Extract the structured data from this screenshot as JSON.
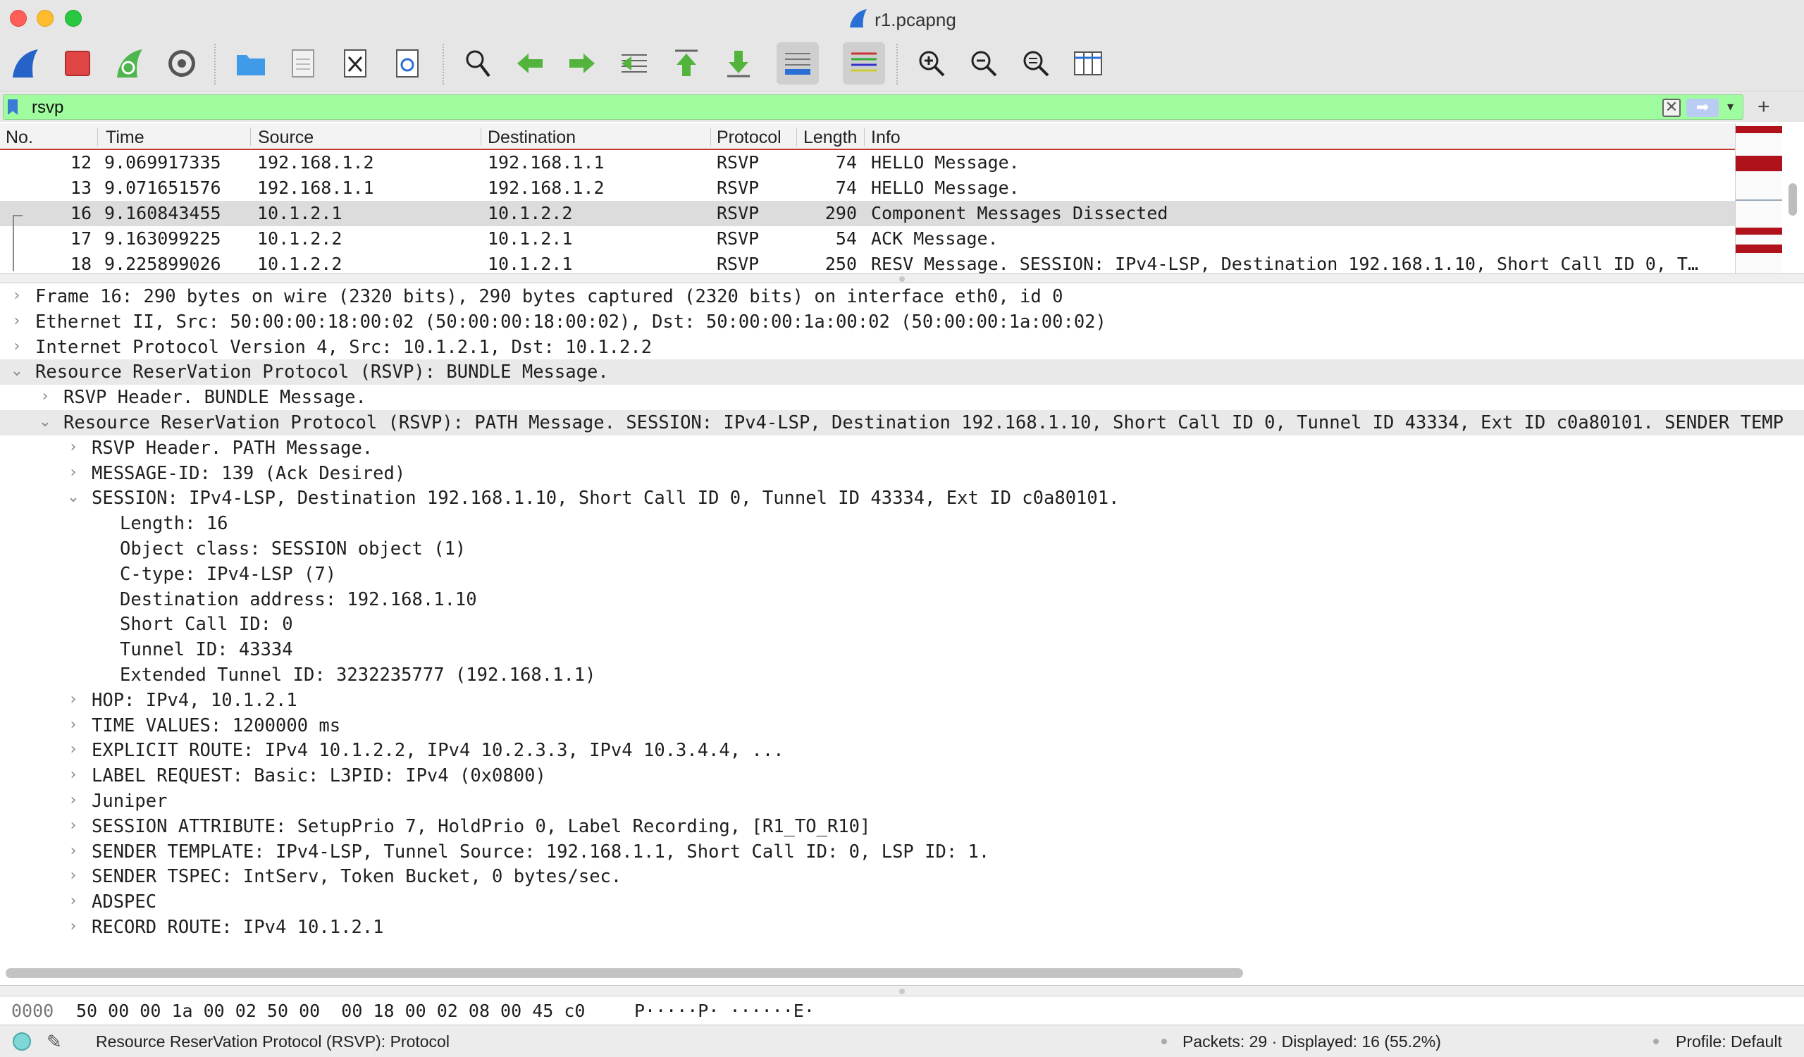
{
  "window": {
    "title": "r1.pcapng"
  },
  "toolbar": {
    "buttons": [
      {
        "icon": "start-capture-icon"
      },
      {
        "icon": "stop-capture-icon"
      },
      {
        "icon": "restart-capture-icon"
      },
      {
        "icon": "capture-options-icon"
      },
      {
        "icon": "open-file-icon"
      },
      {
        "icon": "save-file-icon"
      },
      {
        "icon": "close-file-icon"
      },
      {
        "icon": "reload-file-icon"
      },
      {
        "icon": "find-packet-icon"
      },
      {
        "icon": "go-back-icon"
      },
      {
        "icon": "go-forward-icon"
      },
      {
        "icon": "go-to-packet-icon"
      },
      {
        "icon": "first-packet-icon"
      },
      {
        "icon": "last-packet-icon"
      },
      {
        "icon": "autoscroll-icon"
      },
      {
        "icon": "colorize-icon"
      },
      {
        "icon": "zoom-in-icon"
      },
      {
        "icon": "zoom-out-icon"
      },
      {
        "icon": "normal-size-icon"
      },
      {
        "icon": "resize-columns-icon"
      }
    ]
  },
  "filter": {
    "value": "rsvp",
    "clear": "✕",
    "apply": "➡",
    "dropdown": "▾",
    "add": "+"
  },
  "packet_list": {
    "columns": [
      "No.",
      "Time",
      "Source",
      "Destination",
      "Protocol",
      "Length",
      "Info"
    ],
    "rows": [
      {
        "no": "12",
        "time": "9.069917335",
        "src": "192.168.1.2",
        "dst": "192.168.1.1",
        "proto": "RSVP",
        "len": "74",
        "info": "HELLO Message."
      },
      {
        "no": "13",
        "time": "9.071651576",
        "src": "192.168.1.1",
        "dst": "192.168.1.2",
        "proto": "RSVP",
        "len": "74",
        "info": "HELLO Message."
      },
      {
        "no": "16",
        "time": "9.160843455",
        "src": "10.1.2.1",
        "dst": "10.1.2.2",
        "proto": "RSVP",
        "len": "290",
        "info": "Component Messages Dissected"
      },
      {
        "no": "17",
        "time": "9.163099225",
        "src": "10.1.2.2",
        "dst": "10.1.2.1",
        "proto": "RSVP",
        "len": "54",
        "info": "ACK Message."
      },
      {
        "no": "18",
        "time": "9.225899026",
        "src": "10.1.2.2",
        "dst": "10.1.2.1",
        "proto": "RSVP",
        "len": "250",
        "info": "RESV Message. SESSION: IPv4-LSP, Destination 192.168.1.10, Short Call ID 0, T…"
      }
    ]
  },
  "details": {
    "rows": [
      {
        "level": 0,
        "state": "collapsed",
        "text": "Frame 16: 290 bytes on wire (2320 bits), 290 bytes captured (2320 bits) on interface eth0, id 0"
      },
      {
        "level": 0,
        "state": "collapsed",
        "text": "Ethernet II, Src: 50:00:00:18:00:02 (50:00:00:18:00:02), Dst: 50:00:00:1a:00:02 (50:00:00:1a:00:02)"
      },
      {
        "level": 0,
        "state": "collapsed",
        "text": "Internet Protocol Version 4, Src: 10.1.2.1, Dst: 10.1.2.2"
      },
      {
        "level": 0,
        "state": "expanded",
        "text": "Resource ReserVation Protocol (RSVP): BUNDLE Message."
      },
      {
        "level": 1,
        "state": "collapsed",
        "text": "RSVP Header. BUNDLE Message."
      },
      {
        "level": 1,
        "state": "expanded",
        "text": "Resource ReserVation Protocol (RSVP): PATH Message. SESSION: IPv4-LSP, Destination 192.168.1.10, Short Call ID 0, Tunnel ID 43334, Ext ID c0a80101. SENDER TEMP"
      },
      {
        "level": 2,
        "state": "collapsed",
        "text": "RSVP Header. PATH Message."
      },
      {
        "level": 2,
        "state": "collapsed",
        "text": "MESSAGE-ID: 139 (Ack Desired)"
      },
      {
        "level": 2,
        "state": "expanded",
        "text": "SESSION: IPv4-LSP, Destination 192.168.1.10, Short Call ID 0, Tunnel ID 43334, Ext ID c0a80101."
      },
      {
        "level": 3,
        "state": "leaf",
        "text": "Length: 16"
      },
      {
        "level": 3,
        "state": "leaf",
        "text": "Object class: SESSION object (1)"
      },
      {
        "level": 3,
        "state": "leaf",
        "text": "C-type: IPv4-LSP (7)"
      },
      {
        "level": 3,
        "state": "leaf",
        "text": "Destination address: 192.168.1.10"
      },
      {
        "level": 3,
        "state": "leaf",
        "text": "Short Call ID: 0"
      },
      {
        "level": 3,
        "state": "leaf",
        "text": "Tunnel ID: 43334"
      },
      {
        "level": 3,
        "state": "leaf",
        "text": "Extended Tunnel ID: 3232235777 (192.168.1.1)"
      },
      {
        "level": 2,
        "state": "collapsed",
        "text": "HOP: IPv4, 10.1.2.1"
      },
      {
        "level": 2,
        "state": "collapsed",
        "text": "TIME VALUES: 1200000 ms"
      },
      {
        "level": 2,
        "state": "collapsed",
        "text": "EXPLICIT ROUTE: IPv4 10.1.2.2, IPv4 10.2.3.3, IPv4 10.3.4.4, ..."
      },
      {
        "level": 2,
        "state": "collapsed",
        "text": "LABEL REQUEST: Basic: L3PID: IPv4 (0x0800)"
      },
      {
        "level": 2,
        "state": "collapsed",
        "text": "Juniper"
      },
      {
        "level": 2,
        "state": "collapsed",
        "text": "SESSION ATTRIBUTE: SetupPrio 7, HoldPrio 0, Label Recording,  [R1_TO_R10]"
      },
      {
        "level": 2,
        "state": "collapsed",
        "text": "SENDER TEMPLATE: IPv4-LSP, Tunnel Source: 192.168.1.1, Short Call ID: 0, LSP ID: 1."
      },
      {
        "level": 2,
        "state": "collapsed",
        "text": "SENDER TSPEC: IntServ, Token Bucket, 0 bytes/sec."
      },
      {
        "level": 2,
        "state": "collapsed",
        "text": "ADSPEC"
      },
      {
        "level": 2,
        "state": "collapsed",
        "text": "RECORD ROUTE: IPv4 10.1.2.1"
      }
    ]
  },
  "bytes": {
    "offset": "0000",
    "hex": "50 00 00 1a 00 02 50 00  00 18 00 02 08 00 45 c0",
    "ascii": "P·····P· ······E·"
  },
  "status": {
    "text": "Resource ReserVation Protocol (RSVP): Protocol",
    "packets": "Packets: 29 · Displayed: 16 (55.2%)",
    "profile": "Profile: Default"
  }
}
